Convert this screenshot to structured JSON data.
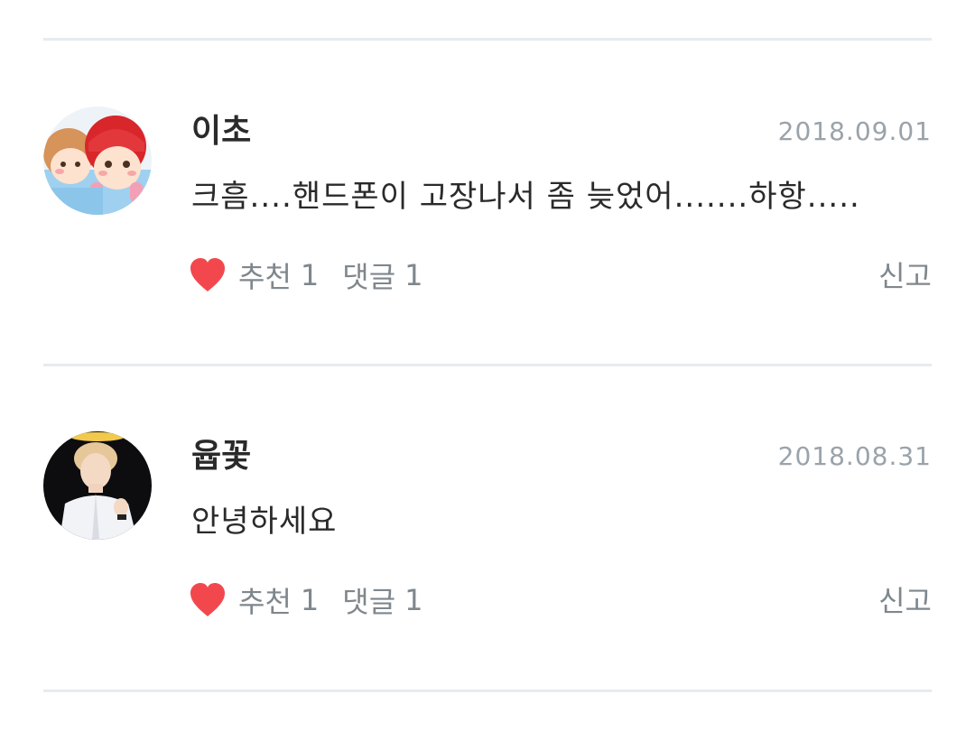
{
  "comments": [
    {
      "username": "이초",
      "date": "2018.09.01",
      "text": "크흠....핸드폰이 고장나서 좀 늦었어.......하항.....",
      "like_label": "추천",
      "like_count": "1",
      "reply_label": "댓글",
      "reply_count": "1",
      "report_label": "신고"
    },
    {
      "username": "윱꽃",
      "date": "2018.08.31",
      "text": "안녕하세요",
      "like_label": "추천",
      "like_count": "1",
      "reply_label": "댓글",
      "reply_count": "1",
      "report_label": "신고"
    }
  ],
  "colors": {
    "heart": "#f2484d",
    "divider": "#e6ebef",
    "date_text": "#9aa3aa",
    "meta_text": "#7f878d"
  },
  "icons": {
    "like": "heart-icon"
  }
}
